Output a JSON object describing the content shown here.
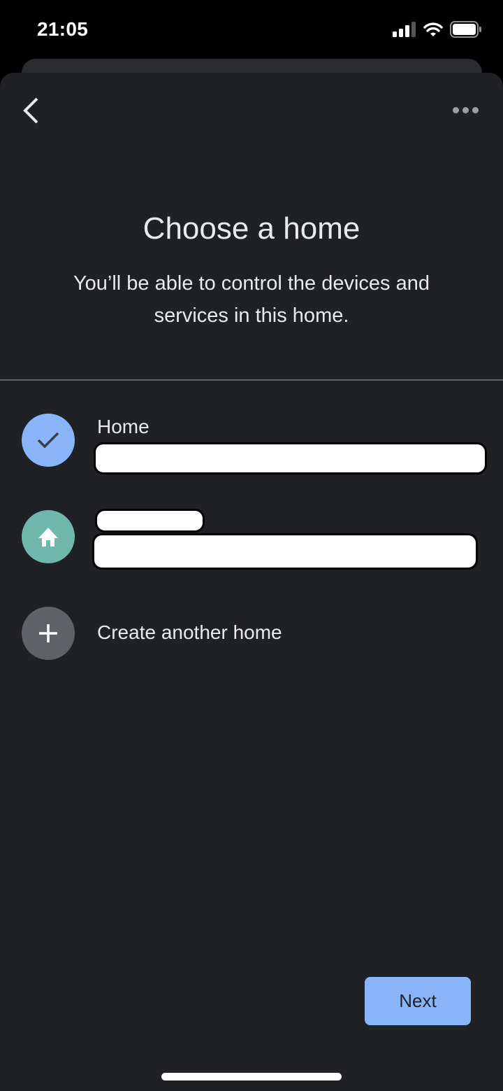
{
  "status_bar": {
    "time": "21:05",
    "icons": [
      "cellular-signal-icon",
      "wifi-icon",
      "battery-icon"
    ]
  },
  "toolbar": {
    "back_icon": "chevron-left-icon",
    "more_icon": "more-horizontal-icon"
  },
  "header": {
    "title": "Choose a home",
    "subtitle": "You’ll be able to control the devices and services in this home."
  },
  "homes": [
    {
      "name": "Home",
      "address": "[redacted]",
      "icon": "check-icon",
      "selected": true,
      "color": "#8ab4f8"
    },
    {
      "name": "[redacted]",
      "address": "[redacted]",
      "icon": "home-icon",
      "selected": false,
      "color": "#6fb6ac"
    }
  ],
  "create_home": {
    "label": "Create another home",
    "icon": "plus-icon",
    "color": "#5f6368"
  },
  "footer": {
    "next_label": "Next"
  },
  "colors": {
    "accent": "#8ab4f8",
    "background": "#202124",
    "text": "#e8eaed"
  }
}
